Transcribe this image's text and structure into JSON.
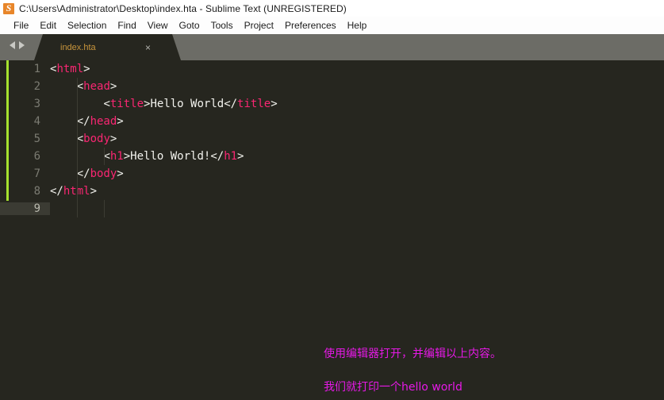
{
  "window": {
    "title": "C:\\Users\\Administrator\\Desktop\\index.hta - Sublime Text (UNREGISTERED)",
    "app_icon": "sublime-text-icon",
    "background_color": "#26261f",
    "title_bar_color": "#ffffff"
  },
  "menu": {
    "items": [
      {
        "label": "File"
      },
      {
        "label": "Edit"
      },
      {
        "label": "Selection"
      },
      {
        "label": "Find"
      },
      {
        "label": "View"
      },
      {
        "label": "Goto"
      },
      {
        "label": "Tools"
      },
      {
        "label": "Project"
      },
      {
        "label": "Preferences"
      },
      {
        "label": "Help"
      }
    ]
  },
  "tab_bar": {
    "background_color": "#6c6c66",
    "prev_icon": "chevron-left-icon",
    "next_icon": "chevron-right-icon",
    "tabs": [
      {
        "label": "index.hta",
        "active": true,
        "label_color": "#c8953c",
        "close_icon": "close-icon",
        "close_label": "×"
      }
    ]
  },
  "editor": {
    "accent_stripe_color": "#a6e22e",
    "active_line": 9,
    "tag_color": "#f92672",
    "text_color": "#f3f3ee",
    "gutter_color": "#7b7b72",
    "lines": [
      {
        "number": "1",
        "indent": 0,
        "segments": [
          {
            "t": "punct",
            "v": "<"
          },
          {
            "t": "tag",
            "v": "html"
          },
          {
            "t": "punct",
            "v": ">"
          }
        ]
      },
      {
        "number": "2",
        "indent": 1,
        "segments": [
          {
            "t": "punct",
            "v": "<"
          },
          {
            "t": "tag",
            "v": "head"
          },
          {
            "t": "punct",
            "v": ">"
          }
        ]
      },
      {
        "number": "3",
        "indent": 2,
        "segments": [
          {
            "t": "punct",
            "v": "<"
          },
          {
            "t": "tag",
            "v": "title"
          },
          {
            "t": "punct",
            "v": ">"
          },
          {
            "t": "txt",
            "v": "Hello World"
          },
          {
            "t": "punct",
            "v": "</"
          },
          {
            "t": "tag",
            "v": "title"
          },
          {
            "t": "punct",
            "v": ">"
          }
        ]
      },
      {
        "number": "4",
        "indent": 1,
        "segments": [
          {
            "t": "punct",
            "v": "</"
          },
          {
            "t": "tag",
            "v": "head"
          },
          {
            "t": "punct",
            "v": ">"
          }
        ]
      },
      {
        "number": "5",
        "indent": 1,
        "segments": [
          {
            "t": "punct",
            "v": "<"
          },
          {
            "t": "tag",
            "v": "body"
          },
          {
            "t": "punct",
            "v": ">"
          }
        ]
      },
      {
        "number": "6",
        "indent": 2,
        "segments": [
          {
            "t": "punct",
            "v": "<"
          },
          {
            "t": "tag",
            "v": "h1"
          },
          {
            "t": "punct",
            "v": ">"
          },
          {
            "t": "txt",
            "v": "Hello World!"
          },
          {
            "t": "punct",
            "v": "</"
          },
          {
            "t": "tag",
            "v": "h1"
          },
          {
            "t": "punct",
            "v": ">"
          }
        ]
      },
      {
        "number": "7",
        "indent": 1,
        "segments": [
          {
            "t": "punct",
            "v": "</"
          },
          {
            "t": "tag",
            "v": "body"
          },
          {
            "t": "punct",
            "v": ">"
          }
        ]
      },
      {
        "number": "8",
        "indent": 0,
        "segments": [
          {
            "t": "punct",
            "v": "</"
          },
          {
            "t": "tag",
            "v": "html"
          },
          {
            "t": "punct",
            "v": ">"
          }
        ]
      },
      {
        "number": "9",
        "indent": 0,
        "segments": []
      }
    ]
  },
  "annotations": {
    "color": "#e619e6",
    "items": [
      {
        "text": "使用编辑器打开，并编辑以上内容。"
      },
      {
        "text": "我们就打印一个hello world"
      }
    ]
  }
}
